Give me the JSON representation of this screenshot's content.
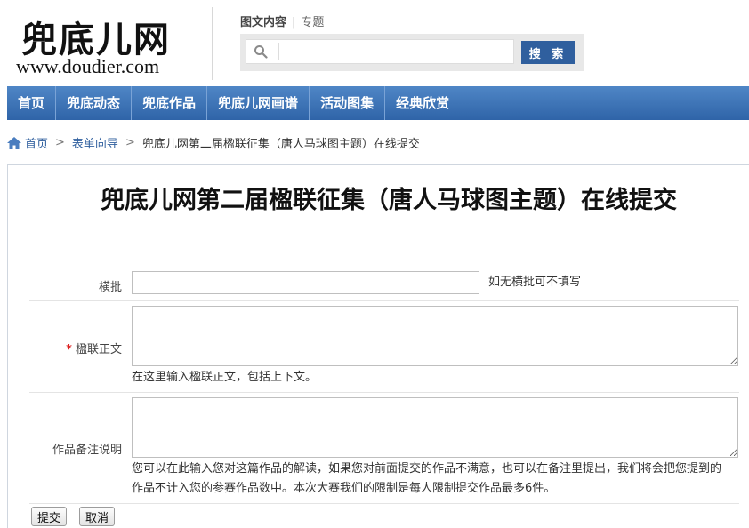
{
  "header": {
    "logo_cn": "兜底儿网",
    "logo_url": "www.doudier.com",
    "search_tabs": [
      "图文内容",
      "专题"
    ],
    "search_value": "",
    "search_button": "搜 索"
  },
  "nav": {
    "items": [
      "首页",
      "兜底动态",
      "兜底作品",
      "兜底儿网画谱",
      "活动图集",
      "经典欣赏"
    ]
  },
  "breadcrumb": {
    "items": [
      "首页",
      "表单向导",
      "兜底儿网第二届楹联征集（唐人马球图主题）在线提交"
    ],
    "separator": ">"
  },
  "form": {
    "title": "兜底儿网第二届楹联征集（唐人马球图主题）在线提交",
    "fields": [
      {
        "label": "横批",
        "value": "",
        "hint": "如无横批可不填写",
        "required": false
      },
      {
        "label": "楹联正文",
        "value": "",
        "hint": "在这里输入楹联正文，包括上下文。",
        "required": true,
        "required_mark": "*"
      },
      {
        "label": "作品备注说明",
        "value": "",
        "hint": "您可以在此输入您对这篇作品的解读，如果您对前面提交的作品不满意，也可以在备注里提出，我们将会把您提到的作品不计入您的参赛作品数中。本次大赛我们的限制是每人限制提交作品最多6件。",
        "required": false
      }
    ],
    "submit_label": "提交",
    "cancel_label": "取消"
  },
  "colors": {
    "nav_bg": "#3a70b3",
    "search_button_bg": "#2f5f9e",
    "link": "#2f5f9e",
    "required": "#dd2222"
  }
}
